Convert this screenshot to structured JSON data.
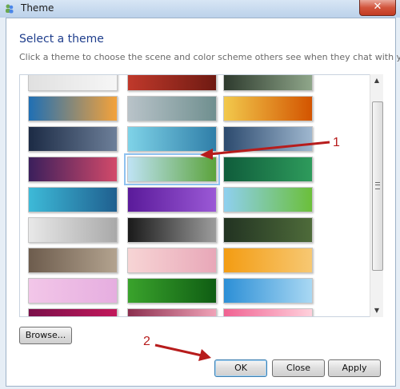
{
  "window": {
    "title": "Theme",
    "close_glyph": "✕"
  },
  "header": {
    "title": "Select a theme",
    "description": "Click a theme to choose the scene and color scheme others see when they chat with you"
  },
  "themes": [
    {
      "c1": "#e0e0e0",
      "c2": "#f6f6f6"
    },
    {
      "c1": "#c0392b",
      "c2": "#6f1a12"
    },
    {
      "c1": "#2e3b2e",
      "c2": "#8fa68a"
    },
    {
      "c1": "#1f6fb4",
      "c2": "#f4a23a"
    },
    {
      "c1": "#b9c3c9",
      "c2": "#6f8f8f"
    },
    {
      "c1": "#f2c94c",
      "c2": "#d35400"
    },
    {
      "c1": "#1c2b45",
      "c2": "#6d7f99"
    },
    {
      "c1": "#7fd3e8",
      "c2": "#2f7ea8"
    },
    {
      "c1": "#2c4a6e",
      "c2": "#9fb7cf"
    },
    {
      "c1": "#3b1f5c",
      "c2": "#d34a6a"
    },
    {
      "c1": "#bfe3f5",
      "c2": "#5ba33b"
    },
    {
      "c1": "#0f5c3b",
      "c2": "#2e9b5c"
    },
    {
      "c1": "#3dbad8",
      "c2": "#1f5f8f"
    },
    {
      "c1": "#5a1a9a",
      "c2": "#9b59d6"
    },
    {
      "c1": "#8fd0f0",
      "c2": "#6bbf3a"
    },
    {
      "c1": "#e8e8e8",
      "c2": "#a9a9a9"
    },
    {
      "c1": "#1a1a1a",
      "c2": "#9c9c9c"
    },
    {
      "c1": "#223322",
      "c2": "#4e6b3a"
    },
    {
      "c1": "#6d5c4d",
      "c2": "#b3a38f"
    },
    {
      "c1": "#f7d5d5",
      "c2": "#e8a7b8"
    },
    {
      "c1": "#f39c12",
      "c2": "#f7c873"
    },
    {
      "c1": "#f2c6e8",
      "c2": "#e6aee0"
    },
    {
      "c1": "#3aa32c",
      "c2": "#0f5d13"
    },
    {
      "c1": "#2c8fd6",
      "c2": "#a9d8f3"
    },
    {
      "c1": "#7a0f4a",
      "c2": "#c2185b"
    },
    {
      "c1": "#8b2f4f",
      "c2": "#f0a3b8"
    },
    {
      "c1": "#f06292",
      "c2": "#ffd1dc"
    }
  ],
  "selected_index": 10,
  "buttons": {
    "browse": "Browse...",
    "ok": "OK",
    "close": "Close",
    "apply": "Apply"
  },
  "annotations": [
    "1",
    "2"
  ],
  "accent": "#1e3d8c",
  "annotation_color": "#b71c1c"
}
